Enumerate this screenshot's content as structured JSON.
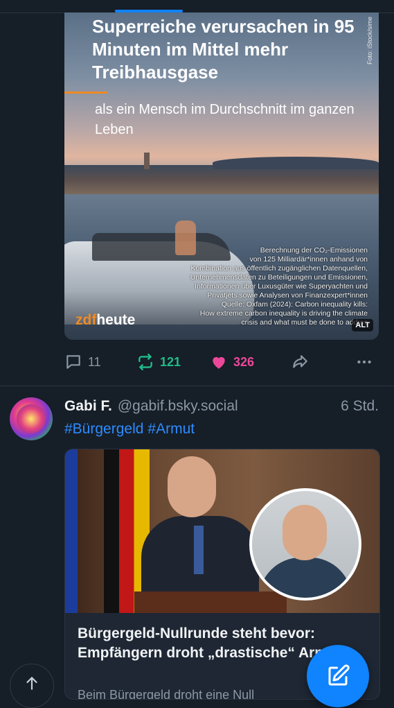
{
  "post1": {
    "image": {
      "headline": "Superreiche verursachen in 95 Minuten im Mittel mehr Treibhausgase",
      "subline": "als ein Mensch im Durchschnitt im ganzen Leben",
      "photo_credit": "Foto: iStock/sime",
      "source_lines": [
        "Berechnung der CO₂-Emissionen",
        "von 125 Milliardär*innen anhand von",
        "Kombination aus öffentlich zugänglichen Datenquellen,",
        "Unternehmensdaten zu Beteiligungen und Emissionen,",
        "Informationen über Luxusgüter wie Superyachten und",
        "Privatjets sowie Analysen von Finanzexpert*innen",
        "Quelle: Oxfam (2024): Carbon inequality kills:",
        "How extreme carbon inequality is driving the climate",
        "crisis and what must be done to addres"
      ],
      "brand_prefix": "zdf",
      "brand_suffix": "heute",
      "alt_badge": "ALT"
    },
    "actions": {
      "replies": "11",
      "reposts": "121",
      "likes": "326"
    }
  },
  "post2": {
    "author_name": "Gabi F.",
    "author_handle": "@gabif.bsky.social",
    "timestamp": "6 Std.",
    "hashtags": [
      "#Bürgergeld",
      "#Armut"
    ],
    "link_card": {
      "title": "Bürgergeld-Nullrunde steht bevor: Empfängern droht „drastische“ Armut",
      "description": "Beim Bürgergeld droht eine Null"
    }
  },
  "colors": {
    "background": "#161e27",
    "accent": "#1083fe",
    "repost": "#20bc8a",
    "like": "#ec4899",
    "muted": "#8b98a5",
    "hashtag": "#2e8cff"
  },
  "icons": [
    "reply-icon",
    "repost-icon",
    "like-icon",
    "share-icon",
    "more-icon",
    "scroll-top-icon",
    "compose-icon"
  ]
}
